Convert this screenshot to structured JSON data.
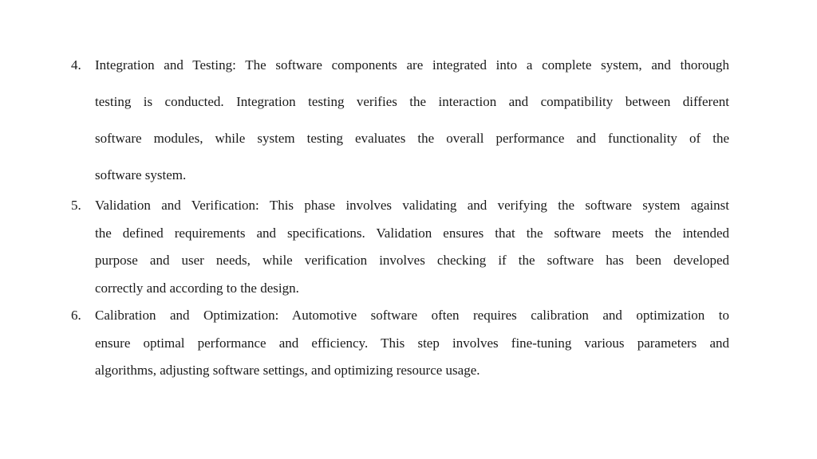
{
  "list": {
    "items": [
      {
        "number": "4.",
        "lines": [
          "Integration and Testing: The software components are integrated into a complete system, and thorough",
          "testing is conducted. Integration testing verifies the interaction and compatibility between different",
          "software modules, while system testing evaluates the overall performance and functionality of the",
          "software system."
        ]
      },
      {
        "number": "5.",
        "lines": [
          "Validation and Verification: This phase involves validating and verifying the software system against",
          "the defined requirements and specifications. Validation ensures that the software meets the intended",
          "purpose and user needs, while verification involves checking if the software has been developed",
          "correctly and according to the design."
        ]
      },
      {
        "number": "6.",
        "lines": [
          "Calibration and Optimization: Automotive software often requires calibration and optimization to",
          "ensure optimal performance and efficiency. This step involves fine-tuning various parameters and",
          "algorithms, adjusting software settings, and optimizing resource usage."
        ]
      }
    ]
  }
}
